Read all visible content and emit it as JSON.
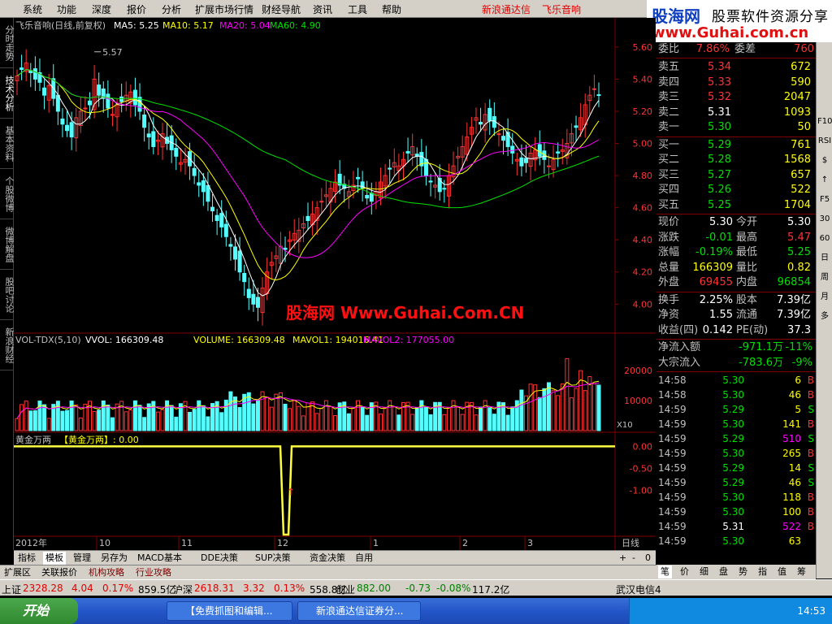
{
  "menu": {
    "items": [
      "系统",
      "功能",
      "深度",
      "报价",
      "分析",
      "扩展市场行情",
      "财经导航",
      "资讯",
      "工具",
      "帮助"
    ],
    "brand": "新浪通达信",
    "stock_title": "飞乐音响"
  },
  "logo": {
    "line1a": "股海网",
    "line1b": "股票软件资源分享",
    "line2": "www.Guhai.com.cn"
  },
  "watermark": "股海网 Www.Guhai.Com.CN",
  "left_tabs": [
    "分时走势",
    "技术分析",
    "基本资料",
    "个股微博",
    "微博解盘",
    "股吧讨论",
    "新浪财经"
  ],
  "price_header": {
    "name": "飞乐音响(日线,前复权)",
    "ma5": "MA5: 5.25",
    "ma10": "MA10: 5.17",
    "ma20": "MA20: 5.04",
    "ma60": "MA60: 4.90"
  },
  "price_annotations": {
    "high": "5.57"
  },
  "vol_header": {
    "title": "VOL-TDX(5,10)",
    "vvol": "VVOL: 166309.48",
    "volume": "VOLUME: 166309.48",
    "mavol1": "MAVOL1: 194016.41",
    "mavol2": "MAVOL2: 177055.00"
  },
  "vol_marker": "X10",
  "ind_header": {
    "title": "黄金万两",
    "name": "【黄金万两】: 0.00"
  },
  "time_axis": {
    "year": "2012年",
    "labels": [
      "10",
      "11",
      "12",
      "1",
      "2",
      "3"
    ],
    "period": "日线"
  },
  "bottom_tabs": [
    "指标",
    "模板",
    "管理",
    "另存为",
    "MACD基本",
    "DDE决策",
    "SUP决策",
    "资金决策",
    "自用"
  ],
  "bottom_tabs2": [
    "扩展区",
    "关联报价",
    "机构攻略",
    "行业攻略"
  ],
  "zoom_ctrl": [
    "+",
    "-",
    "0"
  ],
  "quote": {
    "weibi": {
      "label": "委比",
      "value": "7.86%",
      "label2": "委差",
      "value2": "760"
    },
    "sells": [
      {
        "label": "卖五",
        "price": "5.34",
        "vol": "672"
      },
      {
        "label": "卖四",
        "price": "5.33",
        "vol": "590"
      },
      {
        "label": "卖三",
        "price": "5.32",
        "vol": "2047"
      },
      {
        "label": "卖二",
        "price": "5.31",
        "vol": "1093"
      },
      {
        "label": "卖一",
        "price": "5.30",
        "vol": "50"
      }
    ],
    "buys": [
      {
        "label": "买一",
        "price": "5.29",
        "vol": "761"
      },
      {
        "label": "买二",
        "price": "5.28",
        "vol": "1568"
      },
      {
        "label": "买三",
        "price": "5.27",
        "vol": "657"
      },
      {
        "label": "买四",
        "price": "5.26",
        "vol": "522"
      },
      {
        "label": "买五",
        "price": "5.25",
        "vol": "1704"
      }
    ],
    "stats": [
      {
        "l1": "现价",
        "v1": "5.30",
        "l2": "今开",
        "v2": "5.30"
      },
      {
        "l1": "涨跌",
        "v1": "-0.01",
        "l2": "最高",
        "v2": "5.47"
      },
      {
        "l1": "涨幅",
        "v1": "-0.19%",
        "l2": "最低",
        "v2": "5.25"
      },
      {
        "l1": "总量",
        "v1": "166309",
        "l2": "量比",
        "v2": "0.82"
      },
      {
        "l1": "外盘",
        "v1": "69455",
        "l2": "内盘",
        "v2": "96854"
      }
    ],
    "stats2": [
      {
        "l1": "换手",
        "v1": "2.25%",
        "l2": "股本",
        "v2": "7.39亿"
      },
      {
        "l1": "净资",
        "v1": "1.55",
        "l2": "流通",
        "v2": "7.39亿"
      },
      {
        "l1": "收益(四)",
        "v1": "0.142",
        "l2": "PE(动)",
        "v2": "37.3"
      }
    ],
    "flows": [
      {
        "label": "净流入额",
        "v1": "-971.1万",
        "v2": "-11%"
      },
      {
        "label": "大宗流入",
        "v1": "-783.6万",
        "v2": "-9%"
      }
    ],
    "ticks": [
      {
        "t": "14:58",
        "p": "5.30",
        "v": "6",
        "d": "B"
      },
      {
        "t": "14:58",
        "p": "5.30",
        "v": "46",
        "d": "B"
      },
      {
        "t": "14:59",
        "p": "5.29",
        "v": "5",
        "d": "S"
      },
      {
        "t": "14:59",
        "p": "5.30",
        "v": "141",
        "d": "B"
      },
      {
        "t": "14:59",
        "p": "5.29",
        "v": "510",
        "d": "S"
      },
      {
        "t": "14:59",
        "p": "5.30",
        "v": "265",
        "d": "B"
      },
      {
        "t": "14:59",
        "p": "5.29",
        "v": "14",
        "d": "S"
      },
      {
        "t": "14:59",
        "p": "5.29",
        "v": "46",
        "d": "S"
      },
      {
        "t": "14:59",
        "p": "5.30",
        "v": "118",
        "d": "B"
      },
      {
        "t": "14:59",
        "p": "5.30",
        "v": "100",
        "d": "B"
      },
      {
        "t": "14:59",
        "p": "5.31",
        "v": "522",
        "d": "B"
      },
      {
        "t": "14:59",
        "p": "5.30",
        "v": "63",
        "d": ""
      }
    ],
    "bottom_tabs": [
      "笔",
      "价",
      "细",
      "盘",
      "势",
      "指",
      "值",
      "筹"
    ]
  },
  "right_tool": [
    "F10",
    "RSI",
    "$",
    "↑",
    "F5",
    "30",
    "60",
    "日",
    "周",
    "月",
    "多"
  ],
  "index_bar": [
    {
      "name": "上证",
      "val": "2328.28",
      "chg": "4.04",
      "pct": "0.17%",
      "amt": "859.5亿"
    },
    {
      "name": "沪深",
      "val": "2618.31",
      "chg": "3.32",
      "pct": "0.13%",
      "amt": "558.8亿"
    },
    {
      "name": "创业",
      "val": "882.00",
      "chg": "-0.73",
      "pct": "-0.08%",
      "amt": "117.2亿"
    }
  ],
  "index_right": "武汉电信4",
  "taskbar": {
    "start": "开始",
    "task1": "【免费抓图和编辑...",
    "task2": "新浪通达信证券分...",
    "clock": "14:53"
  },
  "colors": {
    "up": "#ff3232",
    "down": "#54ffff",
    "ma5": "#ffffff",
    "ma10": "#ffff00",
    "ma20": "#ff00ff",
    "ma60": "#00e000",
    "indicator": "#ffff40"
  },
  "chart_data": [
    {
      "type": "candlestick",
      "title": "飞乐音响(日线,前复权)",
      "y_ticks": [
        4.0,
        4.2,
        4.4,
        4.6,
        4.8,
        5.0,
        5.2,
        5.4,
        5.6
      ],
      "ylim": [
        3.86,
        5.68
      ],
      "series": [
        {
          "name": "MA5",
          "value": 5.25
        },
        {
          "name": "MA10",
          "value": 5.17
        },
        {
          "name": "MA20",
          "value": 5.04
        },
        {
          "name": "MA60",
          "value": 4.9
        }
      ],
      "closes": [
        5.42,
        5.46,
        5.5,
        5.44,
        5.4,
        5.38,
        5.3,
        5.36,
        5.28,
        5.2,
        5.12,
        5.08,
        5.04,
        5.16,
        5.2,
        5.22,
        5.24,
        5.4,
        5.3,
        5.28,
        5.22,
        5.18,
        5.24,
        5.26,
        5.3,
        5.32,
        5.24,
        5.2,
        5.1,
        5.04,
        4.98,
        5.02,
        5.06,
        5.0,
        4.96,
        4.92,
        4.88,
        4.9,
        4.86,
        4.8,
        4.74,
        4.7,
        4.64,
        4.58,
        4.52,
        4.48,
        4.42,
        4.36,
        4.28,
        4.2,
        4.14,
        4.04,
        4.0,
        3.98,
        4.1,
        4.2,
        4.26,
        4.3,
        4.36,
        4.34,
        4.4,
        4.44,
        4.46,
        4.5,
        4.52,
        4.56,
        4.6,
        4.64,
        4.68,
        4.72,
        4.76,
        4.74,
        4.72,
        4.7,
        4.74,
        4.78,
        4.72,
        4.66,
        4.64,
        4.7,
        4.76,
        4.8,
        4.84,
        4.88,
        4.86,
        4.9,
        4.94,
        4.98,
        4.92,
        4.86,
        4.8,
        4.76,
        4.74,
        4.7,
        4.72,
        4.8,
        4.86,
        4.92,
        4.98,
        5.04,
        5.1,
        5.16,
        5.12,
        5.18,
        5.14,
        5.1,
        5.06,
        5.02,
        4.98,
        4.94,
        4.9,
        4.86,
        4.88,
        4.94,
        4.96,
        4.92,
        4.9,
        4.86,
        4.9,
        4.94,
        4.96,
        5.0,
        5.06,
        5.1,
        5.16,
        5.24,
        5.3,
        5.34,
        5.3
      ]
    },
    {
      "type": "bar",
      "title": "VOL-TDX(5,10)",
      "y_ticks": [
        10000,
        20000
      ],
      "ylim": [
        0,
        26000
      ],
      "mavol1": 194016.41,
      "mavol2": 177055.0
    },
    {
      "type": "line",
      "title": "黄金万两",
      "y_ticks": [
        0.0,
        -0.5,
        -1.0
      ],
      "ylim": [
        -2.0,
        0.1
      ],
      "values_note": "flat at 0.00 with a single drop to about -2.0 near mid-December"
    }
  ]
}
